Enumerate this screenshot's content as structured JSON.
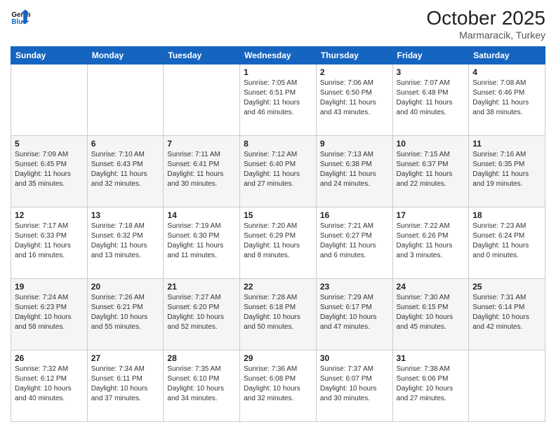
{
  "header": {
    "logo_general": "General",
    "logo_blue": "Blue",
    "month": "October 2025",
    "location": "Marmaracik, Turkey"
  },
  "weekdays": [
    "Sunday",
    "Monday",
    "Tuesday",
    "Wednesday",
    "Thursday",
    "Friday",
    "Saturday"
  ],
  "weeks": [
    [
      {
        "day": "",
        "data": ""
      },
      {
        "day": "",
        "data": ""
      },
      {
        "day": "",
        "data": ""
      },
      {
        "day": "1",
        "data": "Sunrise: 7:05 AM\nSunset: 6:51 PM\nDaylight: 11 hours and 46 minutes."
      },
      {
        "day": "2",
        "data": "Sunrise: 7:06 AM\nSunset: 6:50 PM\nDaylight: 11 hours and 43 minutes."
      },
      {
        "day": "3",
        "data": "Sunrise: 7:07 AM\nSunset: 6:48 PM\nDaylight: 11 hours and 40 minutes."
      },
      {
        "day": "4",
        "data": "Sunrise: 7:08 AM\nSunset: 6:46 PM\nDaylight: 11 hours and 38 minutes."
      }
    ],
    [
      {
        "day": "5",
        "data": "Sunrise: 7:09 AM\nSunset: 6:45 PM\nDaylight: 11 hours and 35 minutes."
      },
      {
        "day": "6",
        "data": "Sunrise: 7:10 AM\nSunset: 6:43 PM\nDaylight: 11 hours and 32 minutes."
      },
      {
        "day": "7",
        "data": "Sunrise: 7:11 AM\nSunset: 6:41 PM\nDaylight: 11 hours and 30 minutes."
      },
      {
        "day": "8",
        "data": "Sunrise: 7:12 AM\nSunset: 6:40 PM\nDaylight: 11 hours and 27 minutes."
      },
      {
        "day": "9",
        "data": "Sunrise: 7:13 AM\nSunset: 6:38 PM\nDaylight: 11 hours and 24 minutes."
      },
      {
        "day": "10",
        "data": "Sunrise: 7:15 AM\nSunset: 6:37 PM\nDaylight: 11 hours and 22 minutes."
      },
      {
        "day": "11",
        "data": "Sunrise: 7:16 AM\nSunset: 6:35 PM\nDaylight: 11 hours and 19 minutes."
      }
    ],
    [
      {
        "day": "12",
        "data": "Sunrise: 7:17 AM\nSunset: 6:33 PM\nDaylight: 11 hours and 16 minutes."
      },
      {
        "day": "13",
        "data": "Sunrise: 7:18 AM\nSunset: 6:32 PM\nDaylight: 11 hours and 13 minutes."
      },
      {
        "day": "14",
        "data": "Sunrise: 7:19 AM\nSunset: 6:30 PM\nDaylight: 11 hours and 11 minutes."
      },
      {
        "day": "15",
        "data": "Sunrise: 7:20 AM\nSunset: 6:29 PM\nDaylight: 11 hours and 8 minutes."
      },
      {
        "day": "16",
        "data": "Sunrise: 7:21 AM\nSunset: 6:27 PM\nDaylight: 11 hours and 6 minutes."
      },
      {
        "day": "17",
        "data": "Sunrise: 7:22 AM\nSunset: 6:26 PM\nDaylight: 11 hours and 3 minutes."
      },
      {
        "day": "18",
        "data": "Sunrise: 7:23 AM\nSunset: 6:24 PM\nDaylight: 11 hours and 0 minutes."
      }
    ],
    [
      {
        "day": "19",
        "data": "Sunrise: 7:24 AM\nSunset: 6:23 PM\nDaylight: 10 hours and 58 minutes."
      },
      {
        "day": "20",
        "data": "Sunrise: 7:26 AM\nSunset: 6:21 PM\nDaylight: 10 hours and 55 minutes."
      },
      {
        "day": "21",
        "data": "Sunrise: 7:27 AM\nSunset: 6:20 PM\nDaylight: 10 hours and 52 minutes."
      },
      {
        "day": "22",
        "data": "Sunrise: 7:28 AM\nSunset: 6:18 PM\nDaylight: 10 hours and 50 minutes."
      },
      {
        "day": "23",
        "data": "Sunrise: 7:29 AM\nSunset: 6:17 PM\nDaylight: 10 hours and 47 minutes."
      },
      {
        "day": "24",
        "data": "Sunrise: 7:30 AM\nSunset: 6:15 PM\nDaylight: 10 hours and 45 minutes."
      },
      {
        "day": "25",
        "data": "Sunrise: 7:31 AM\nSunset: 6:14 PM\nDaylight: 10 hours and 42 minutes."
      }
    ],
    [
      {
        "day": "26",
        "data": "Sunrise: 7:32 AM\nSunset: 6:12 PM\nDaylight: 10 hours and 40 minutes."
      },
      {
        "day": "27",
        "data": "Sunrise: 7:34 AM\nSunset: 6:11 PM\nDaylight: 10 hours and 37 minutes."
      },
      {
        "day": "28",
        "data": "Sunrise: 7:35 AM\nSunset: 6:10 PM\nDaylight: 10 hours and 34 minutes."
      },
      {
        "day": "29",
        "data": "Sunrise: 7:36 AM\nSunset: 6:08 PM\nDaylight: 10 hours and 32 minutes."
      },
      {
        "day": "30",
        "data": "Sunrise: 7:37 AM\nSunset: 6:07 PM\nDaylight: 10 hours and 30 minutes."
      },
      {
        "day": "31",
        "data": "Sunrise: 7:38 AM\nSunset: 6:06 PM\nDaylight: 10 hours and 27 minutes."
      },
      {
        "day": "",
        "data": ""
      }
    ]
  ]
}
